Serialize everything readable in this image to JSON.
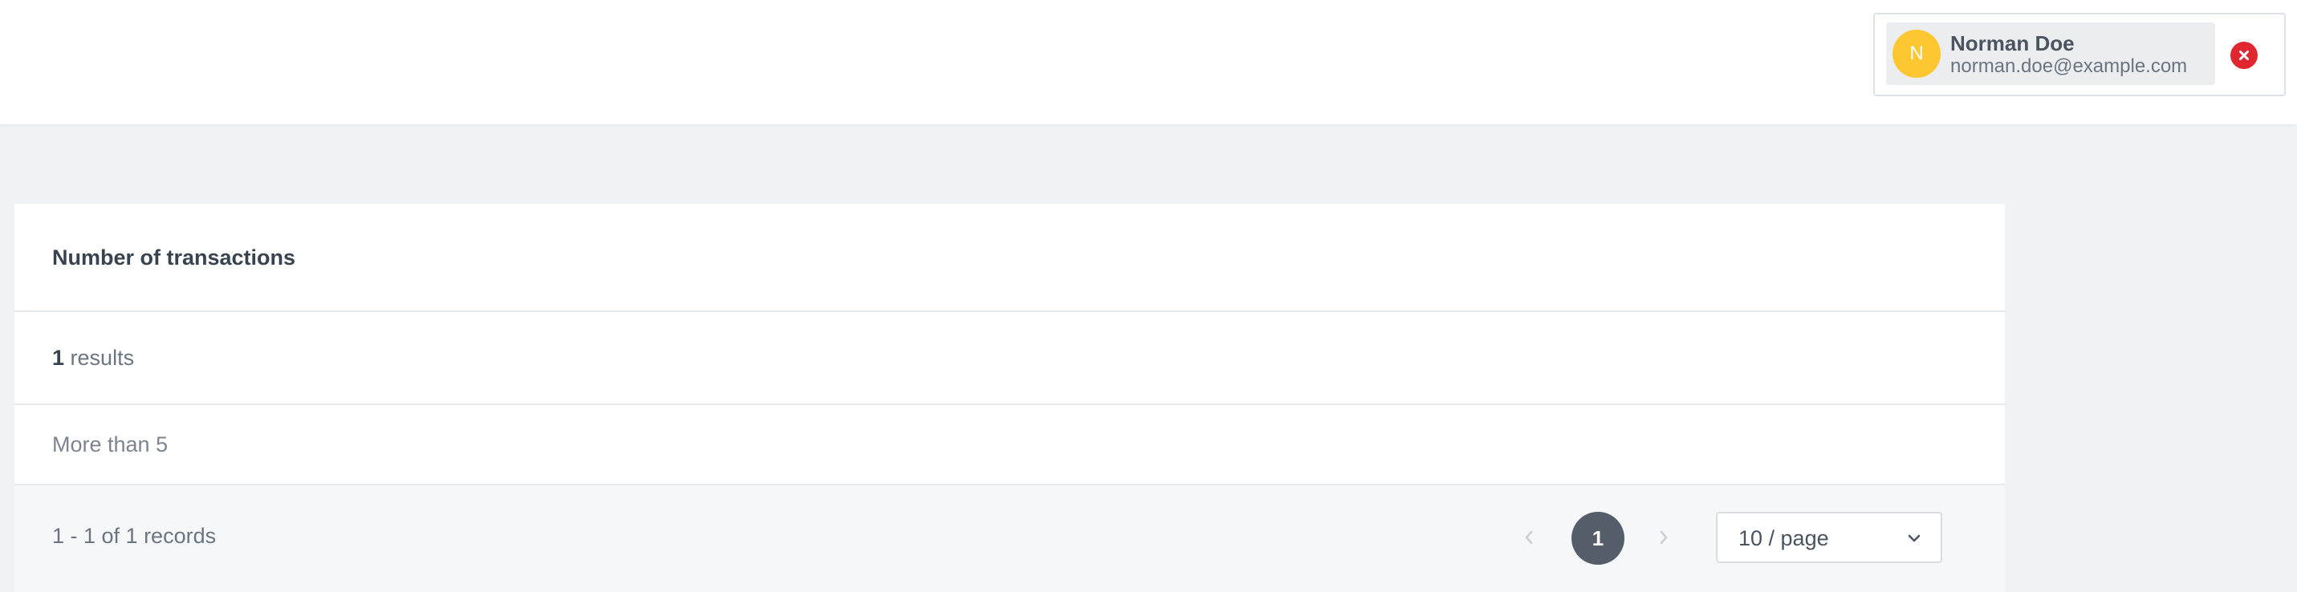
{
  "user": {
    "initial": "N",
    "name": "Norman Doe",
    "email": "norman.doe@example.com",
    "avatar_color": "#fcc731",
    "remove_icon": "close-circle-icon",
    "remove_color": "#e0262f"
  },
  "card": {
    "title": "Number of transactions",
    "results_count": "1",
    "results_label": "results",
    "rows": [
      {
        "label": "More than 5"
      }
    ]
  },
  "pagination": {
    "summary": "1 - 1 of 1 records",
    "prev_icon": "chevron-left-icon",
    "next_icon": "chevron-right-icon",
    "current_page": "1",
    "page_size": "10 / page",
    "page_size_icon": "chevron-down-icon",
    "active_color": "#545d6a"
  }
}
